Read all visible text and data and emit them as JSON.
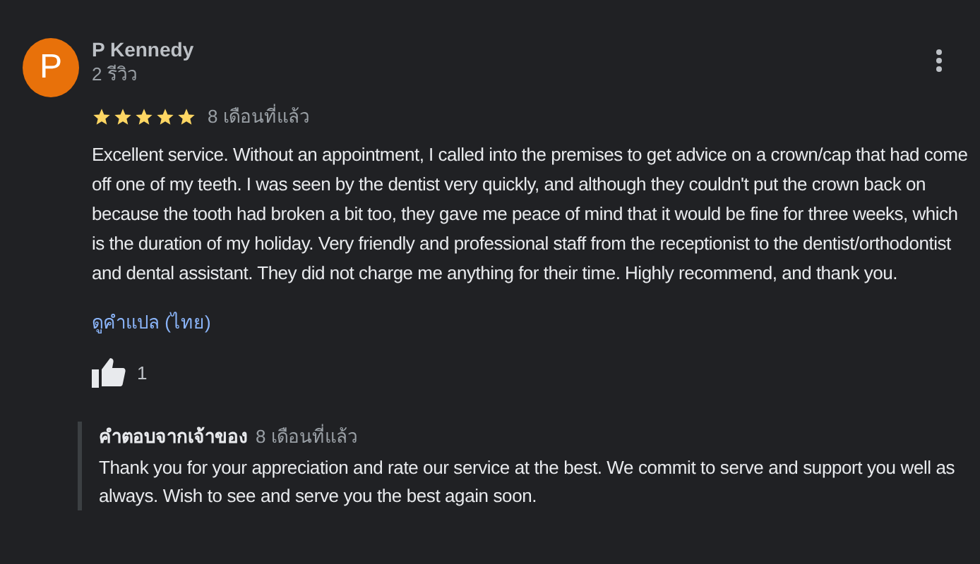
{
  "review": {
    "avatar_letter": "P",
    "author": "P Kennedy",
    "review_count": "2 รีวิว",
    "stars": 5,
    "time": "8 เดือนที่แล้ว",
    "text": "Excellent service.  Without an appointment, I called into the premises to get advice on a crown/cap that had come off one of my teeth.  I was seen by the dentist very quickly, and although they couldn't put the crown back on because the tooth had broken a bit too, they gave me peace of mind that it would be fine for three weeks, which is the duration of my holiday. Very friendly and professional staff from the receptionist to the dentist/orthodontist and dental assistant.  They did not charge me anything for their time.  Highly recommend, and thank you.",
    "translate_link": "ดูคำแปล (ไทย)",
    "likes": "1"
  },
  "owner_reply": {
    "label": "คำตอบจากเจ้าของ",
    "time": "8 เดือนที่แล้ว",
    "text": "Thank you for your appreciation and rate our service at the best. We commit to serve and support you well as always. Wish to see and serve you the best again soon."
  }
}
